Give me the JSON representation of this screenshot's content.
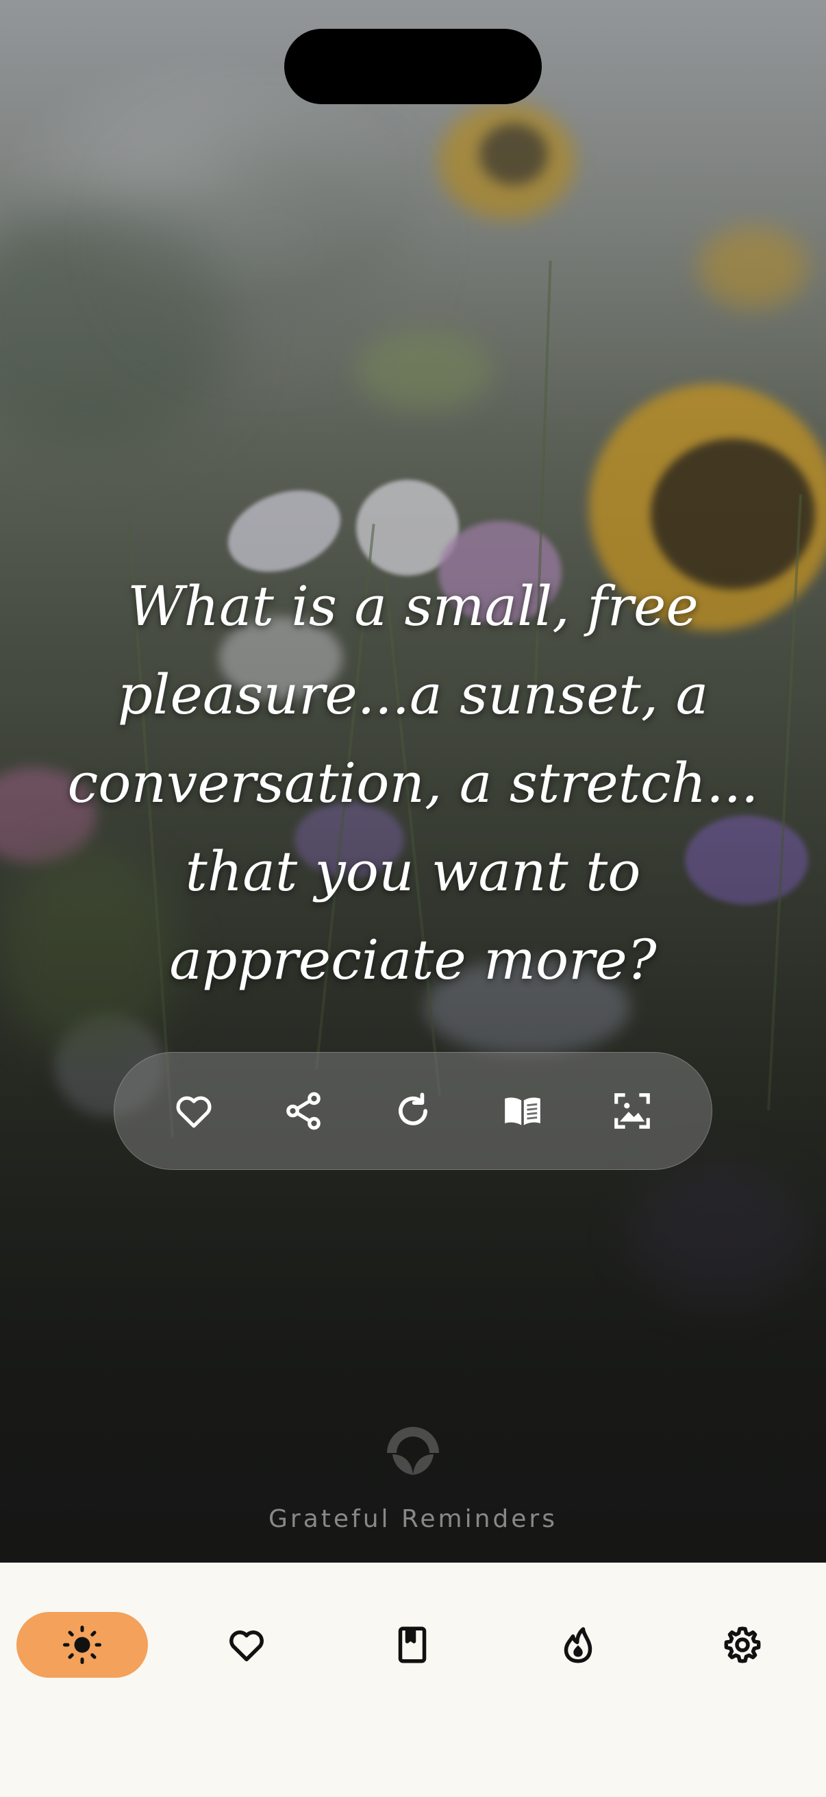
{
  "prompt": {
    "lines": [
      "What is a small, free",
      "pleasure...a sunset, a",
      "conversation, a stretch...",
      "that you want to",
      "appreciate more?"
    ]
  },
  "actions": [
    {
      "icon": "heart-icon",
      "label": "Favorite"
    },
    {
      "icon": "share-icon",
      "label": "Share"
    },
    {
      "icon": "refresh-icon",
      "label": "New prompt"
    },
    {
      "icon": "book-open-icon",
      "label": "Journal"
    },
    {
      "icon": "image-frame-icon",
      "label": "Change background"
    }
  ],
  "brand": {
    "name": "Grateful Reminders",
    "logo_icon": "sprout-logo-icon"
  },
  "tabbar": {
    "active_color": "#f3a15b",
    "background": "#f9f8f3",
    "tabs": [
      {
        "icon": "sun-icon",
        "active": true
      },
      {
        "icon": "heart-icon",
        "active": false
      },
      {
        "icon": "bookmark-book-icon",
        "active": false
      },
      {
        "icon": "flame-icon",
        "active": false
      },
      {
        "icon": "gear-icon",
        "active": false
      }
    ]
  }
}
